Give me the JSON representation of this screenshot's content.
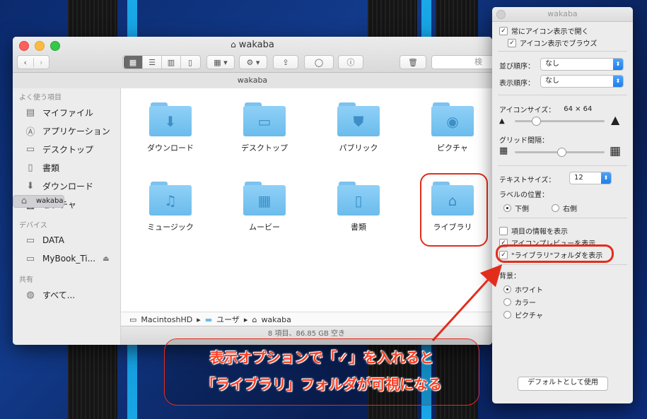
{
  "finder": {
    "title": "wakaba",
    "path_header": "wakaba",
    "search_placeholder": "検",
    "sidebar": {
      "favorites_header": "よく使う項目",
      "favorites": [
        {
          "label": "マイファイル",
          "icon": "all-files-icon"
        },
        {
          "label": "アプリケーション",
          "icon": "applications-icon"
        },
        {
          "label": "デスクトップ",
          "icon": "desktop-icon"
        },
        {
          "label": "書類",
          "icon": "documents-icon"
        },
        {
          "label": "ダウンロード",
          "icon": "downloads-icon"
        },
        {
          "label": "wakaba",
          "icon": "home-icon",
          "selected": true
        },
        {
          "label": "ピクチャ",
          "icon": "pictures-icon"
        }
      ],
      "devices_header": "デバイス",
      "devices": [
        {
          "label": "DATA",
          "icon": "disk-icon"
        },
        {
          "label": "MyBook_Ti...",
          "icon": "disk-icon"
        }
      ],
      "shared_header": "共有",
      "shared": [
        {
          "label": "すべて...",
          "icon": "network-icon"
        }
      ]
    },
    "items": [
      {
        "label": "ダウンロード",
        "glyph": "⬇"
      },
      {
        "label": "デスクトップ",
        "glyph": "▭"
      },
      {
        "label": "パブリック",
        "glyph": "⛊"
      },
      {
        "label": "ピクチャ",
        "glyph": "📷"
      },
      {
        "label": "ミュージック",
        "glyph": "♫"
      },
      {
        "label": "ムービー",
        "glyph": "▦"
      },
      {
        "label": "書類",
        "glyph": "▯"
      },
      {
        "label": "ライブラリ",
        "glyph": "🏛"
      }
    ],
    "breadcrumb": [
      "MacintoshHD",
      "ユーザ",
      "wakaba"
    ],
    "status": "8 項目、86.85 GB 空き"
  },
  "panel": {
    "title": "wakaba",
    "always_open": "常にアイコン表示で開く",
    "browse_icon": "アイコン表示でブラウズ",
    "sort_label": "並び順序：",
    "sort_value": "なし",
    "arrange_label": "表示順序：",
    "arrange_value": "なし",
    "icon_size_label": "アイコンサイズ：",
    "icon_size_value": "64 × 64",
    "grid_label": "グリッド間隔：",
    "text_size_label": "テキストサイズ：",
    "text_size_value": "12",
    "label_pos_label": "ラベルの位置：",
    "label_bottom": "下側",
    "label_right": "右側",
    "show_info": "項目の情報を表示",
    "show_preview": "アイコンプレビューを表示",
    "show_library": "\"ライブラリ\"フォルダを表示",
    "background_label": "背景：",
    "bg_white": "ホワイト",
    "bg_color": "カラー",
    "bg_picture": "ピクチャ",
    "default_button": "デフォルトとして使用"
  },
  "annotation": {
    "line1": "表示オプションで「✓」を入れると",
    "line2": "「ライブラリ」フォルダが可視になる"
  }
}
